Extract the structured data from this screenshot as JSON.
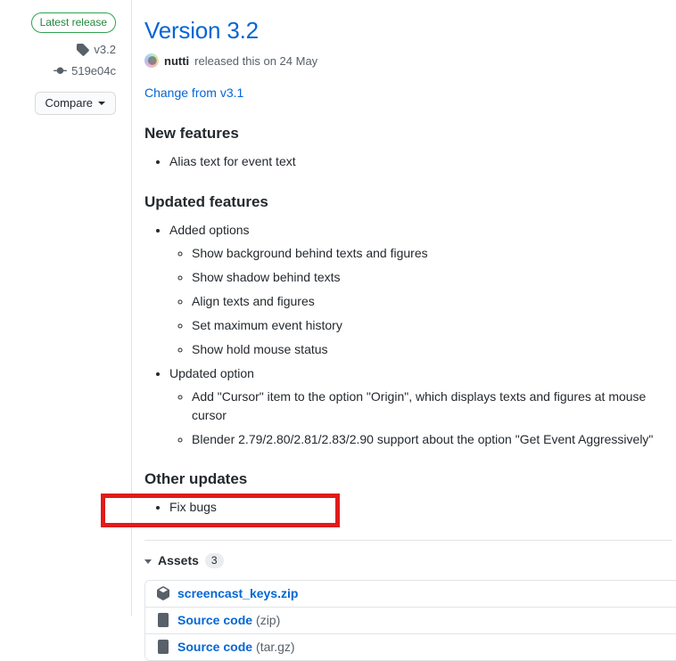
{
  "sidebar": {
    "latest_release_badge": "Latest release",
    "tag_icon": "tag-icon",
    "tag_label": "v3.2",
    "commit_icon": "commit-icon",
    "commit_label": "519e04c",
    "compare_button": "Compare",
    "compare_caret_icon": "chevron-down-icon"
  },
  "release": {
    "title": "Version 3.2",
    "author_avatar_icon": "avatar-image",
    "author": "nutti",
    "byline_suffix": "released this on 24 May",
    "change_link": "Change from v3.1"
  },
  "sections": [
    {
      "heading": "New features",
      "items": [
        {
          "text": "Alias text for event text",
          "children": []
        }
      ]
    },
    {
      "heading": "Updated features",
      "items": [
        {
          "text": "Added options",
          "children": [
            "Show background behind texts and figures",
            "Show shadow behind texts",
            "Align texts and figures",
            "Set maximum event history",
            "Show hold mouse status"
          ]
        },
        {
          "text": "Updated option",
          "children": [
            "Add \"Cursor\" item to the option \"Origin\", which displays texts and figures at mouse cursor",
            "Blender 2.79/2.80/2.81/2.83/2.90 support about the option \"Get Event Aggressively\""
          ]
        }
      ]
    },
    {
      "heading": "Other updates",
      "items": [
        {
          "text": "Fix bugs",
          "children": []
        }
      ]
    }
  ],
  "assets": {
    "toggle_icon": "chevron-down-icon",
    "label": "Assets",
    "count": "3",
    "rows": [
      {
        "icon": "package-icon",
        "name": "screencast_keys.zip",
        "suffix": ""
      },
      {
        "icon": "file-zip-icon",
        "name": "Source code",
        "suffix": "(zip)"
      },
      {
        "icon": "file-zip-icon",
        "name": "Source code",
        "suffix": "(tar.gz)"
      }
    ]
  },
  "annotation": {
    "highlight_name": "red-highlight-box",
    "highlight_color": "#e01b1b"
  },
  "colors": {
    "link": "#0366d6",
    "text": "#24292e",
    "muted": "#586069",
    "border": "#e1e4e8",
    "green": "#2ea44f"
  }
}
